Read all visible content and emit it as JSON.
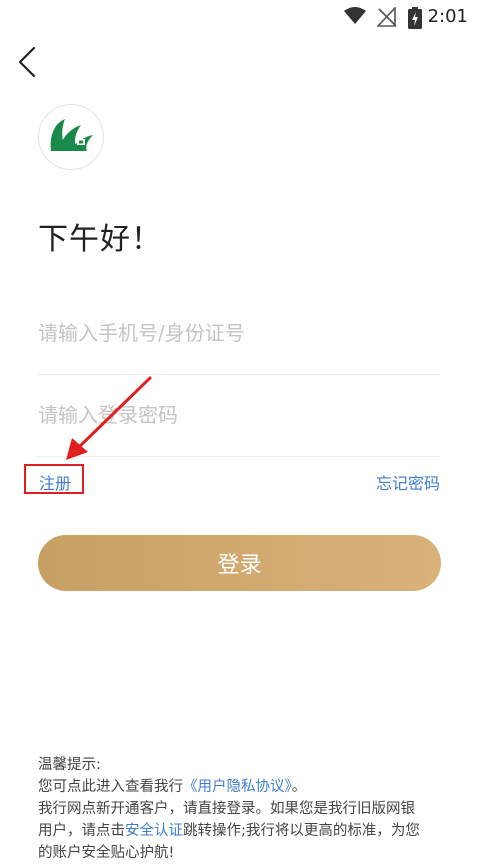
{
  "status_bar": {
    "time": "2:01",
    "icons": [
      "wifi-icon",
      "no-signal-icon",
      "battery-charging-icon"
    ]
  },
  "nav": {
    "back_icon": "chevron-left-icon"
  },
  "logo": {
    "colors": [
      "#1a8a4a",
      "#ffffff"
    ]
  },
  "greeting": "下午好！",
  "form": {
    "account_placeholder": "请输入手机号/身份证号",
    "account_value": "",
    "password_placeholder": "请输入登录密码",
    "password_value": ""
  },
  "links": {
    "register": "注册",
    "forgot_password": "忘记密码"
  },
  "login_button": "登录",
  "tips": {
    "title": "温馨提示:",
    "line1_prefix": "您可点此进入查看我行",
    "privacy_link": "《用户隐私协议》",
    "line1_suffix": "。",
    "line2": "我行网点新开通客户，请直接登录。如果您是我行旧版网银",
    "line3_prefix": "用户，请点击",
    "security_link": "安全认证",
    "line3_suffix": "跳转操作;我行将以更高的标准，为您",
    "line4": "的账户安全贴心护航!"
  },
  "colors": {
    "accent_link": "#3f7fd0",
    "button_gold_start": "#c7a064",
    "button_gold_end": "#d9b27a",
    "annotation_red": "#e02020"
  }
}
